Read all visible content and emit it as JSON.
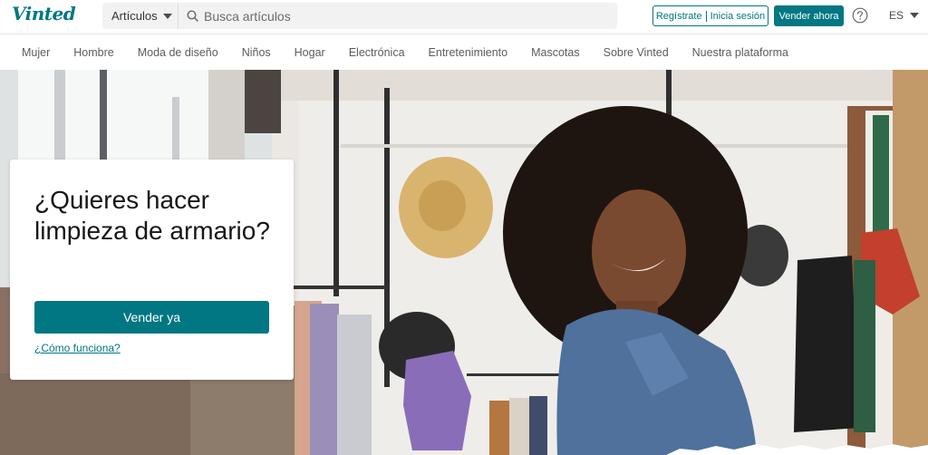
{
  "header": {
    "logo": "Vinted",
    "category_select": "Artículos",
    "search_placeholder": "Busca artículos",
    "auth_register": "Regístrate",
    "auth_login": "Inicia sesión",
    "sell_button": "Vender ahora",
    "language": "ES"
  },
  "nav": {
    "items": [
      "Mujer",
      "Hombre",
      "Moda de diseño",
      "Niños",
      "Hogar",
      "Electrónica",
      "Entretenimiento",
      "Mascotas",
      "Sobre Vinted",
      "Nuestra plataforma"
    ]
  },
  "hero": {
    "title": "¿Quieres hacer limpieza de armario?",
    "cta_button": "Vender ya",
    "how_link": "¿Cómo funciona?"
  },
  "colors": {
    "brand": "#007782",
    "text": "#171717",
    "nav_text": "#5c5c5c",
    "search_bg": "#f2f2f2"
  },
  "icons": [
    "search-icon",
    "help-icon",
    "chevron-down-icon"
  ]
}
